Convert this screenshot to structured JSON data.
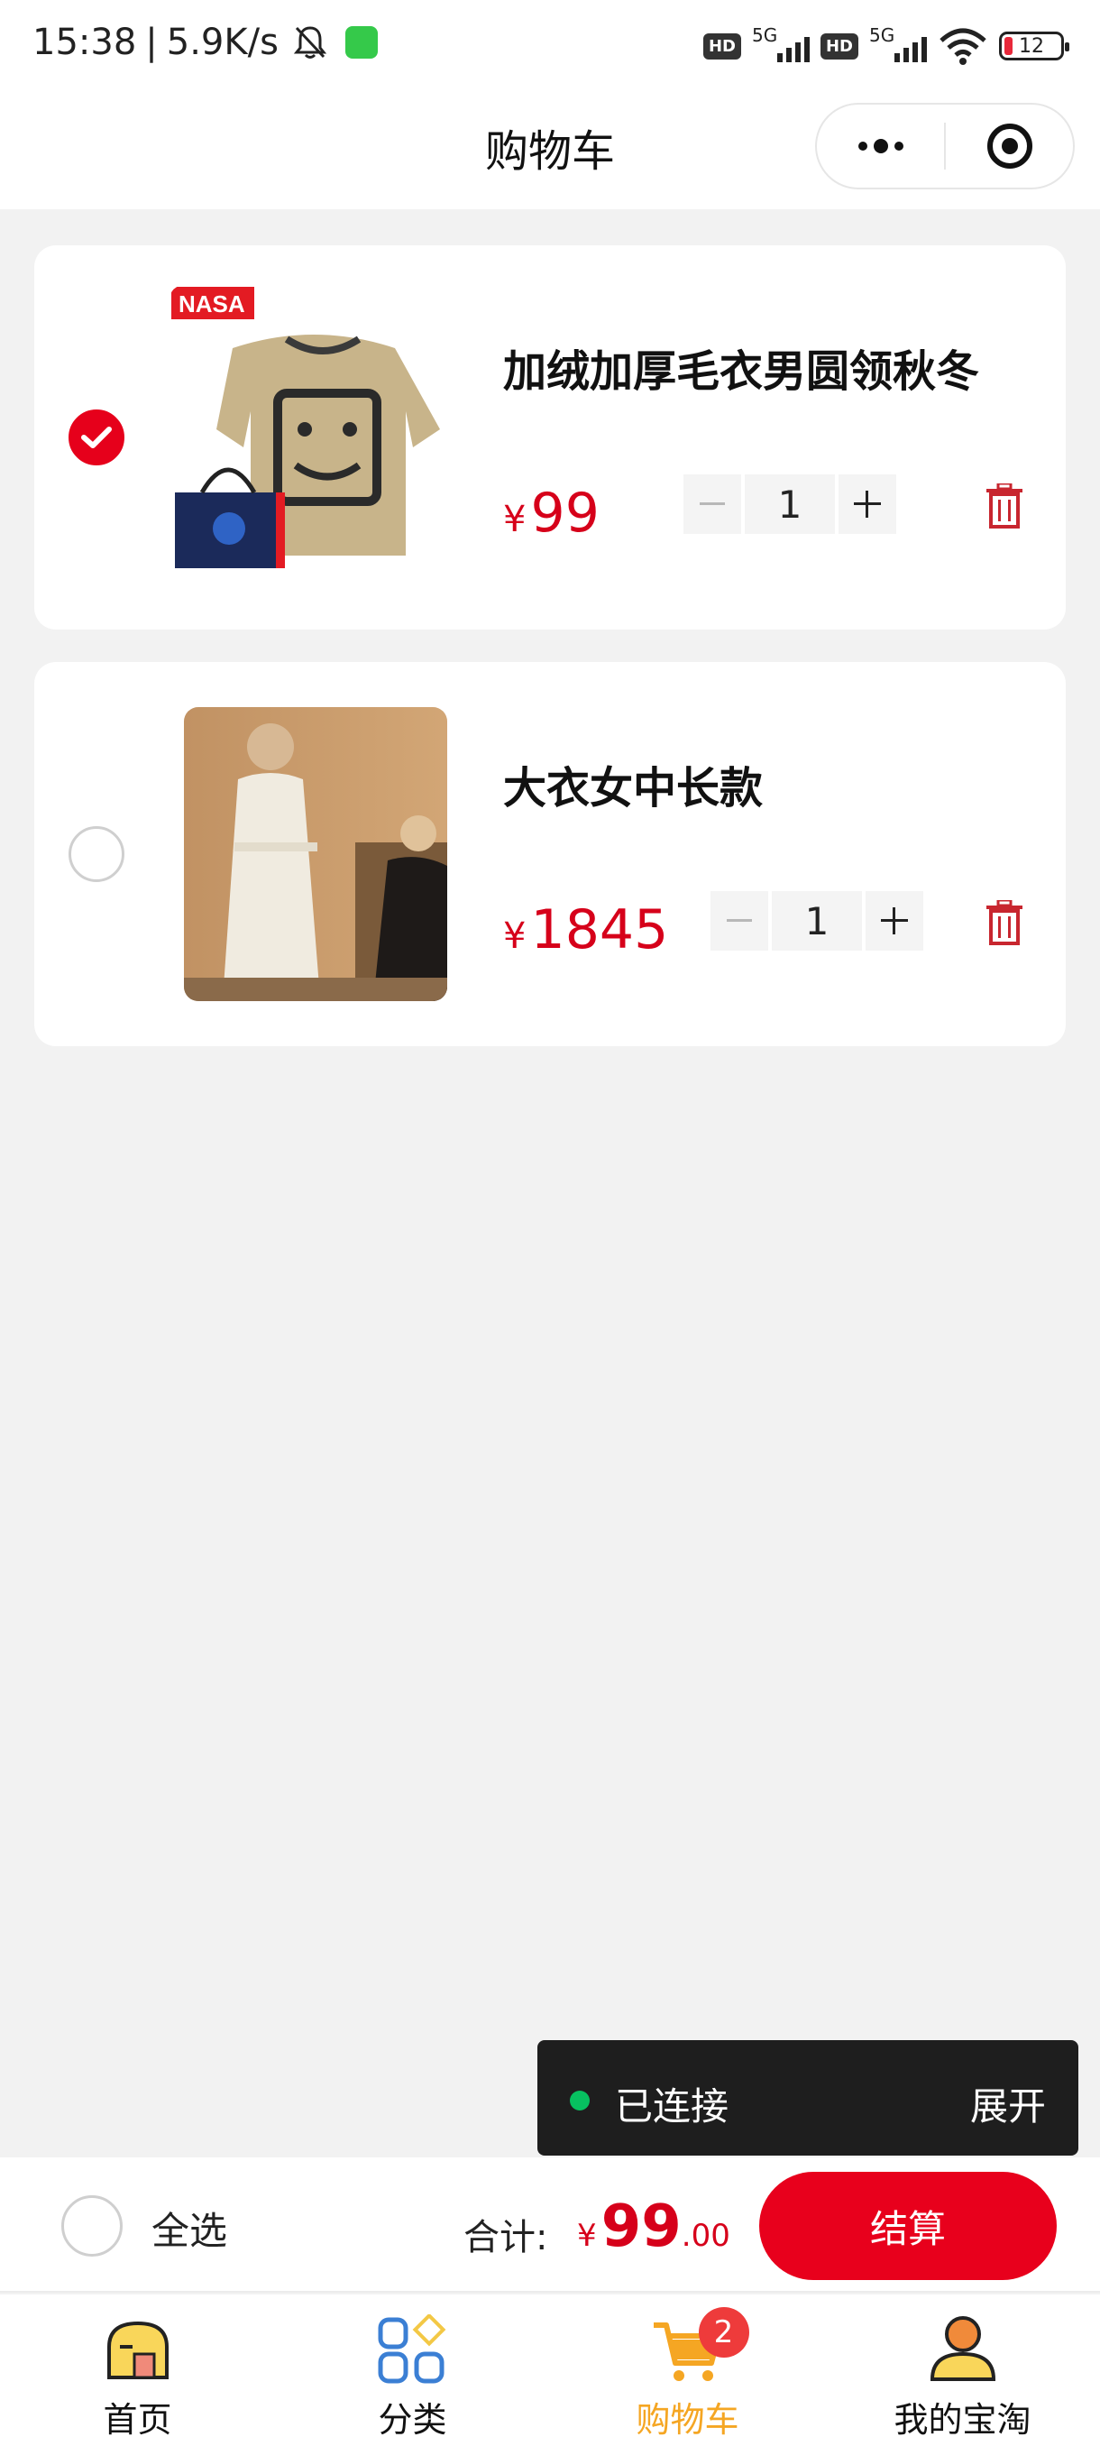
{
  "status_bar": {
    "time": "15:38",
    "speed": "5.9K/s",
    "network_1": "5G",
    "network_2": "5G",
    "battery": "12",
    "icons": [
      "mute-bell-icon",
      "app-notification-icon",
      "hd-icon",
      "signal-icon",
      "wifi-icon",
      "battery-icon"
    ]
  },
  "nav": {
    "title": "购物车",
    "icons": [
      "more-icon",
      "target-icon"
    ]
  },
  "cart": {
    "items": [
      {
        "name": "加绒加厚毛衣男圆领秋冬",
        "currency": "¥",
        "price": "99",
        "quantity": "1",
        "checked": true
      },
      {
        "name": "大衣女中长款",
        "currency": "¥",
        "price": "1845",
        "quantity": "1",
        "checked": false
      }
    ]
  },
  "toast": {
    "status": "已连接",
    "action": "展开"
  },
  "checkout": {
    "select_all": "全选",
    "total_label": "合计:",
    "currency": "¥",
    "total_int": "99",
    "total_dec": ".00",
    "button": "结算"
  },
  "tabs": [
    {
      "label": "首页",
      "icon": "home-icon"
    },
    {
      "label": "分类",
      "icon": "category-icon"
    },
    {
      "label": "购物车",
      "icon": "cart-icon",
      "badge": "2",
      "active": true
    },
    {
      "label": "我的宝淘",
      "icon": "profile-icon"
    }
  ],
  "colors": {
    "accent_red": "#e8001c",
    "price_red": "#d6001a",
    "active_tab": "#f5a623",
    "toast_bg": "#1e1e1e",
    "connected_dot": "#07c160"
  }
}
